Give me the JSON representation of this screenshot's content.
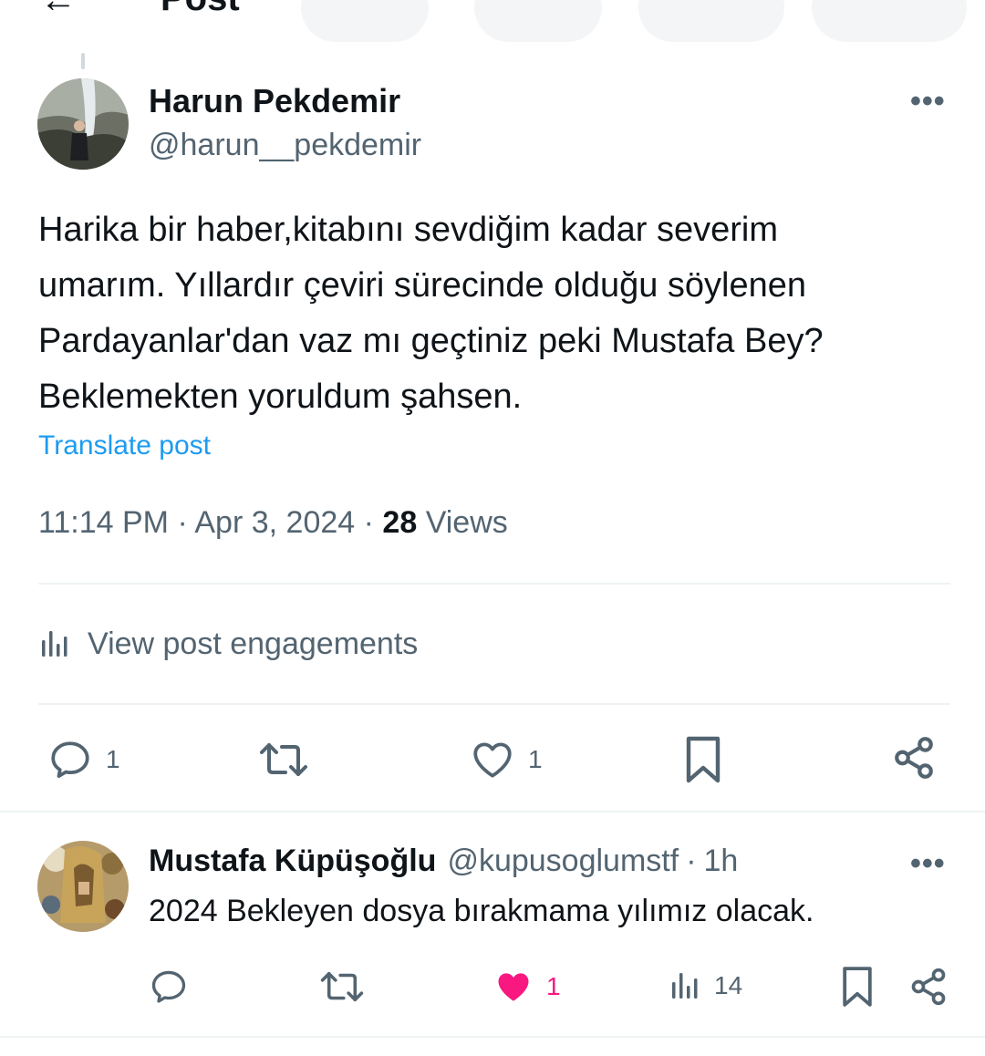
{
  "header": {
    "back_icon": "arrow-left-icon",
    "title": "Post"
  },
  "post": {
    "author_name": "Harun Pekdemir",
    "author_handle": "@harun__pekdemir",
    "text_lines": [
      "Harika bir haber,kitabını sevdiğim kadar severim",
      "umarım. Yıllardır çeviri sürecinde olduğu söylenen",
      "Pardayanlar'dan vaz mı geçtiniz peki Mustafa Bey?",
      "Beklemekten yoruldum şahsen."
    ],
    "translate_label": "Translate post",
    "time": "11:14 PM",
    "date": "Apr 3, 2024",
    "views_count": "28",
    "views_label": "Views",
    "engagements_label": "View post engagements",
    "actions": {
      "reply_count": "1",
      "repost_count": "",
      "like_count": "1"
    }
  },
  "reply": {
    "author_name": "Mustafa Küpüşoğlu",
    "author_handle": "@kupusoglumstf",
    "time_ago": "1h",
    "text": "2024 Bekleyen dosya bırakmama yılımız olacak.",
    "actions": {
      "like_count": "1",
      "views_count": "14"
    }
  },
  "colors": {
    "accent": "#1d9bf0",
    "like_active": "#f91880",
    "secondary_text": "#536471",
    "divider": "#eff3f4"
  }
}
